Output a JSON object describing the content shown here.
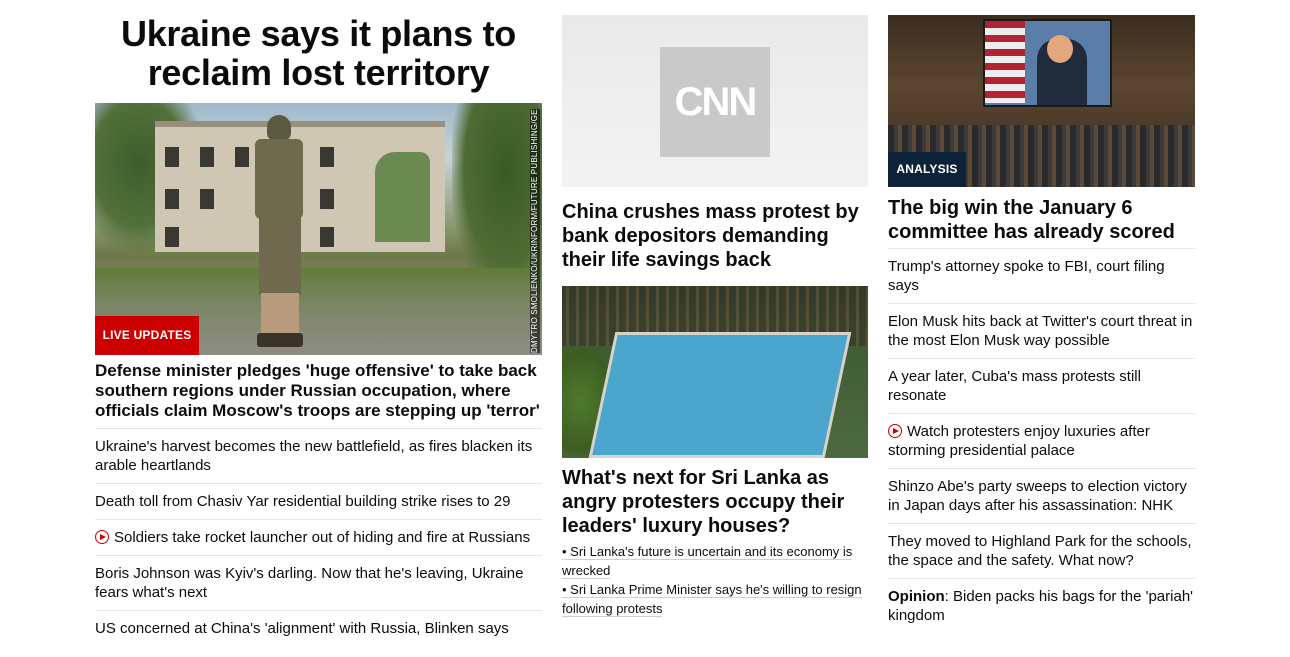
{
  "col1": {
    "headline": "Ukraine says it plans to reclaim lost territory",
    "image_credit": "DMYTRO SMOLIENKO/UKRINFORM/FUTURE PUBLISHING/GETTY IMAGES",
    "badge": "LIVE UPDATES",
    "lead": "Defense minister pledges 'huge offensive' to take back southern regions under Russian occupation, where officials claim Moscow's troops are stepping up 'terror'",
    "links": [
      {
        "text": "Ukraine's harvest becomes the new battlefield, as fires blacken its arable heartlands",
        "video": false
      },
      {
        "text": "Death toll from Chasiv Yar residential building strike rises to 29",
        "video": false
      },
      {
        "text": "Soldiers take rocket launcher out of hiding and fire at Russians",
        "video": true
      },
      {
        "text": "Boris Johnson was Kyiv's darling. Now that he's leaving, Ukraine fears what's next",
        "video": false
      },
      {
        "text": "US concerned at China's 'alignment' with Russia, Blinken says",
        "video": false
      }
    ]
  },
  "col2": {
    "logo": "CNN",
    "china_headline": "China crushes mass protest by bank depositors demanding their life savings back",
    "srilanka_headline": "What's next for Sri Lanka as angry protesters occupy their leaders' luxury houses?",
    "bullets": [
      "• Sri Lanka's future is uncertain and its economy is wrecked",
      "• Sri Lanka Prime Minister says he's willing to resign following protests"
    ]
  },
  "col3": {
    "badge": "ANALYSIS",
    "headline": "The big win the January 6 committee has already scored",
    "links": [
      {
        "text": "Trump's attorney spoke to FBI, court filing says",
        "video": false
      },
      {
        "text": "Elon Musk hits back at Twitter's court threat in the most Elon Musk way possible",
        "video": false
      },
      {
        "text": "A year later, Cuba's mass protests still resonate",
        "video": false
      },
      {
        "text": "Watch protesters enjoy luxuries after storming presidential palace",
        "video": true
      },
      {
        "text": "Shinzo Abe's party sweeps to election victory in Japan days after his assassination: NHK",
        "video": false
      },
      {
        "text": "They moved to Highland Park for the schools, the space and the safety. What now?",
        "video": false
      }
    ],
    "opinion_label": "Opinion",
    "opinion_text": ": Biden packs his bags for the 'pariah' kingdom"
  }
}
